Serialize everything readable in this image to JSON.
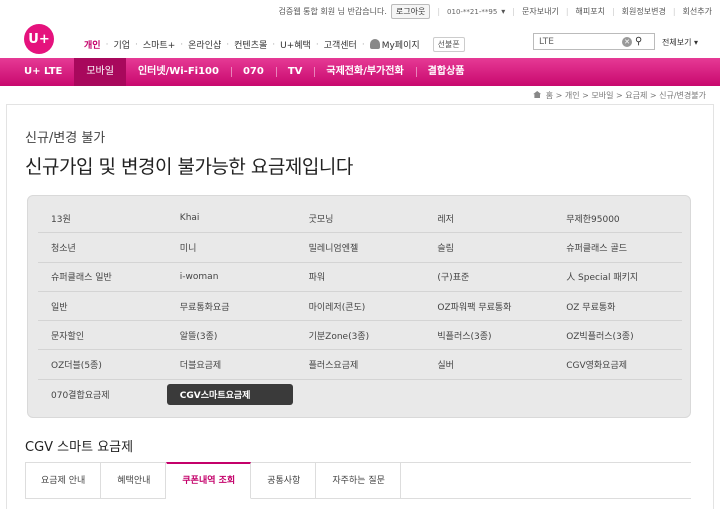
{
  "util": {
    "greeting": "검증웹 통합 회원 님 반갑습니다.",
    "logout": "로그아웃",
    "phone": "010-**21-**95",
    "links": [
      "문자보내기",
      "해피포치",
      "회원정보변경",
      "회선추가"
    ]
  },
  "logo": "U+",
  "gnb": {
    "items": [
      "개인",
      "기업",
      "스마트+",
      "온라인샵",
      "컨텐츠몰",
      "U+혜택",
      "고객센터",
      "My페이지"
    ],
    "badge": "선불폰"
  },
  "search": {
    "value": "LTE"
  },
  "fullview": "전체보기",
  "mainnav": [
    "U+ LTE",
    "모바일",
    "인터넷/Wi-Fi100",
    "070",
    "TV",
    "국제전화/부가전화",
    "결합상품"
  ],
  "breadcrumb": "홈 > 개인 > 모바일 > 요금제 > 신규/변경불가",
  "content": {
    "subtitle": "신규/변경 불가",
    "title": "신규가입 및 변경이 불가능한 요금제입니다",
    "plans": [
      [
        "13원",
        "Khai",
        "굿모닝",
        "레저",
        "무제한95000"
      ],
      [
        "청소년",
        "미니",
        "밀레니엄엔젤",
        "슬림",
        "슈퍼클래스 골드"
      ],
      [
        "슈퍼클래스 일반",
        "i-woman",
        "파워",
        "(구)표준",
        "人 Special 패키지"
      ],
      [
        "일반",
        "무료통화요금",
        "마이레저(콘도)",
        "OZ파워팩 무료통화",
        "OZ 무료통화"
      ],
      [
        "문자할인",
        "알뜰(3종)",
        "기분Zone(3종)",
        "빅플러스(3종)",
        "OZ빅플러스(3종)"
      ],
      [
        "OZ더블(5종)",
        "더블요금제",
        "플러스요금제",
        "실버",
        "CGV영화요금제"
      ],
      [
        "070결합요금제",
        "CGV스마트요금제",
        "",
        "",
        ""
      ]
    ],
    "selected_plan": "CGV스마트요금제",
    "section_title": "CGV 스마트 요금제",
    "tabs": [
      "요금제 안내",
      "혜택안내",
      "쿠폰내역 조회",
      "공통사항",
      "자주하는 질문"
    ],
    "active_tab": "쿠폰내역 조회"
  },
  "colors": {
    "brand": "#e5127d",
    "nav_active": "#a8085c"
  }
}
